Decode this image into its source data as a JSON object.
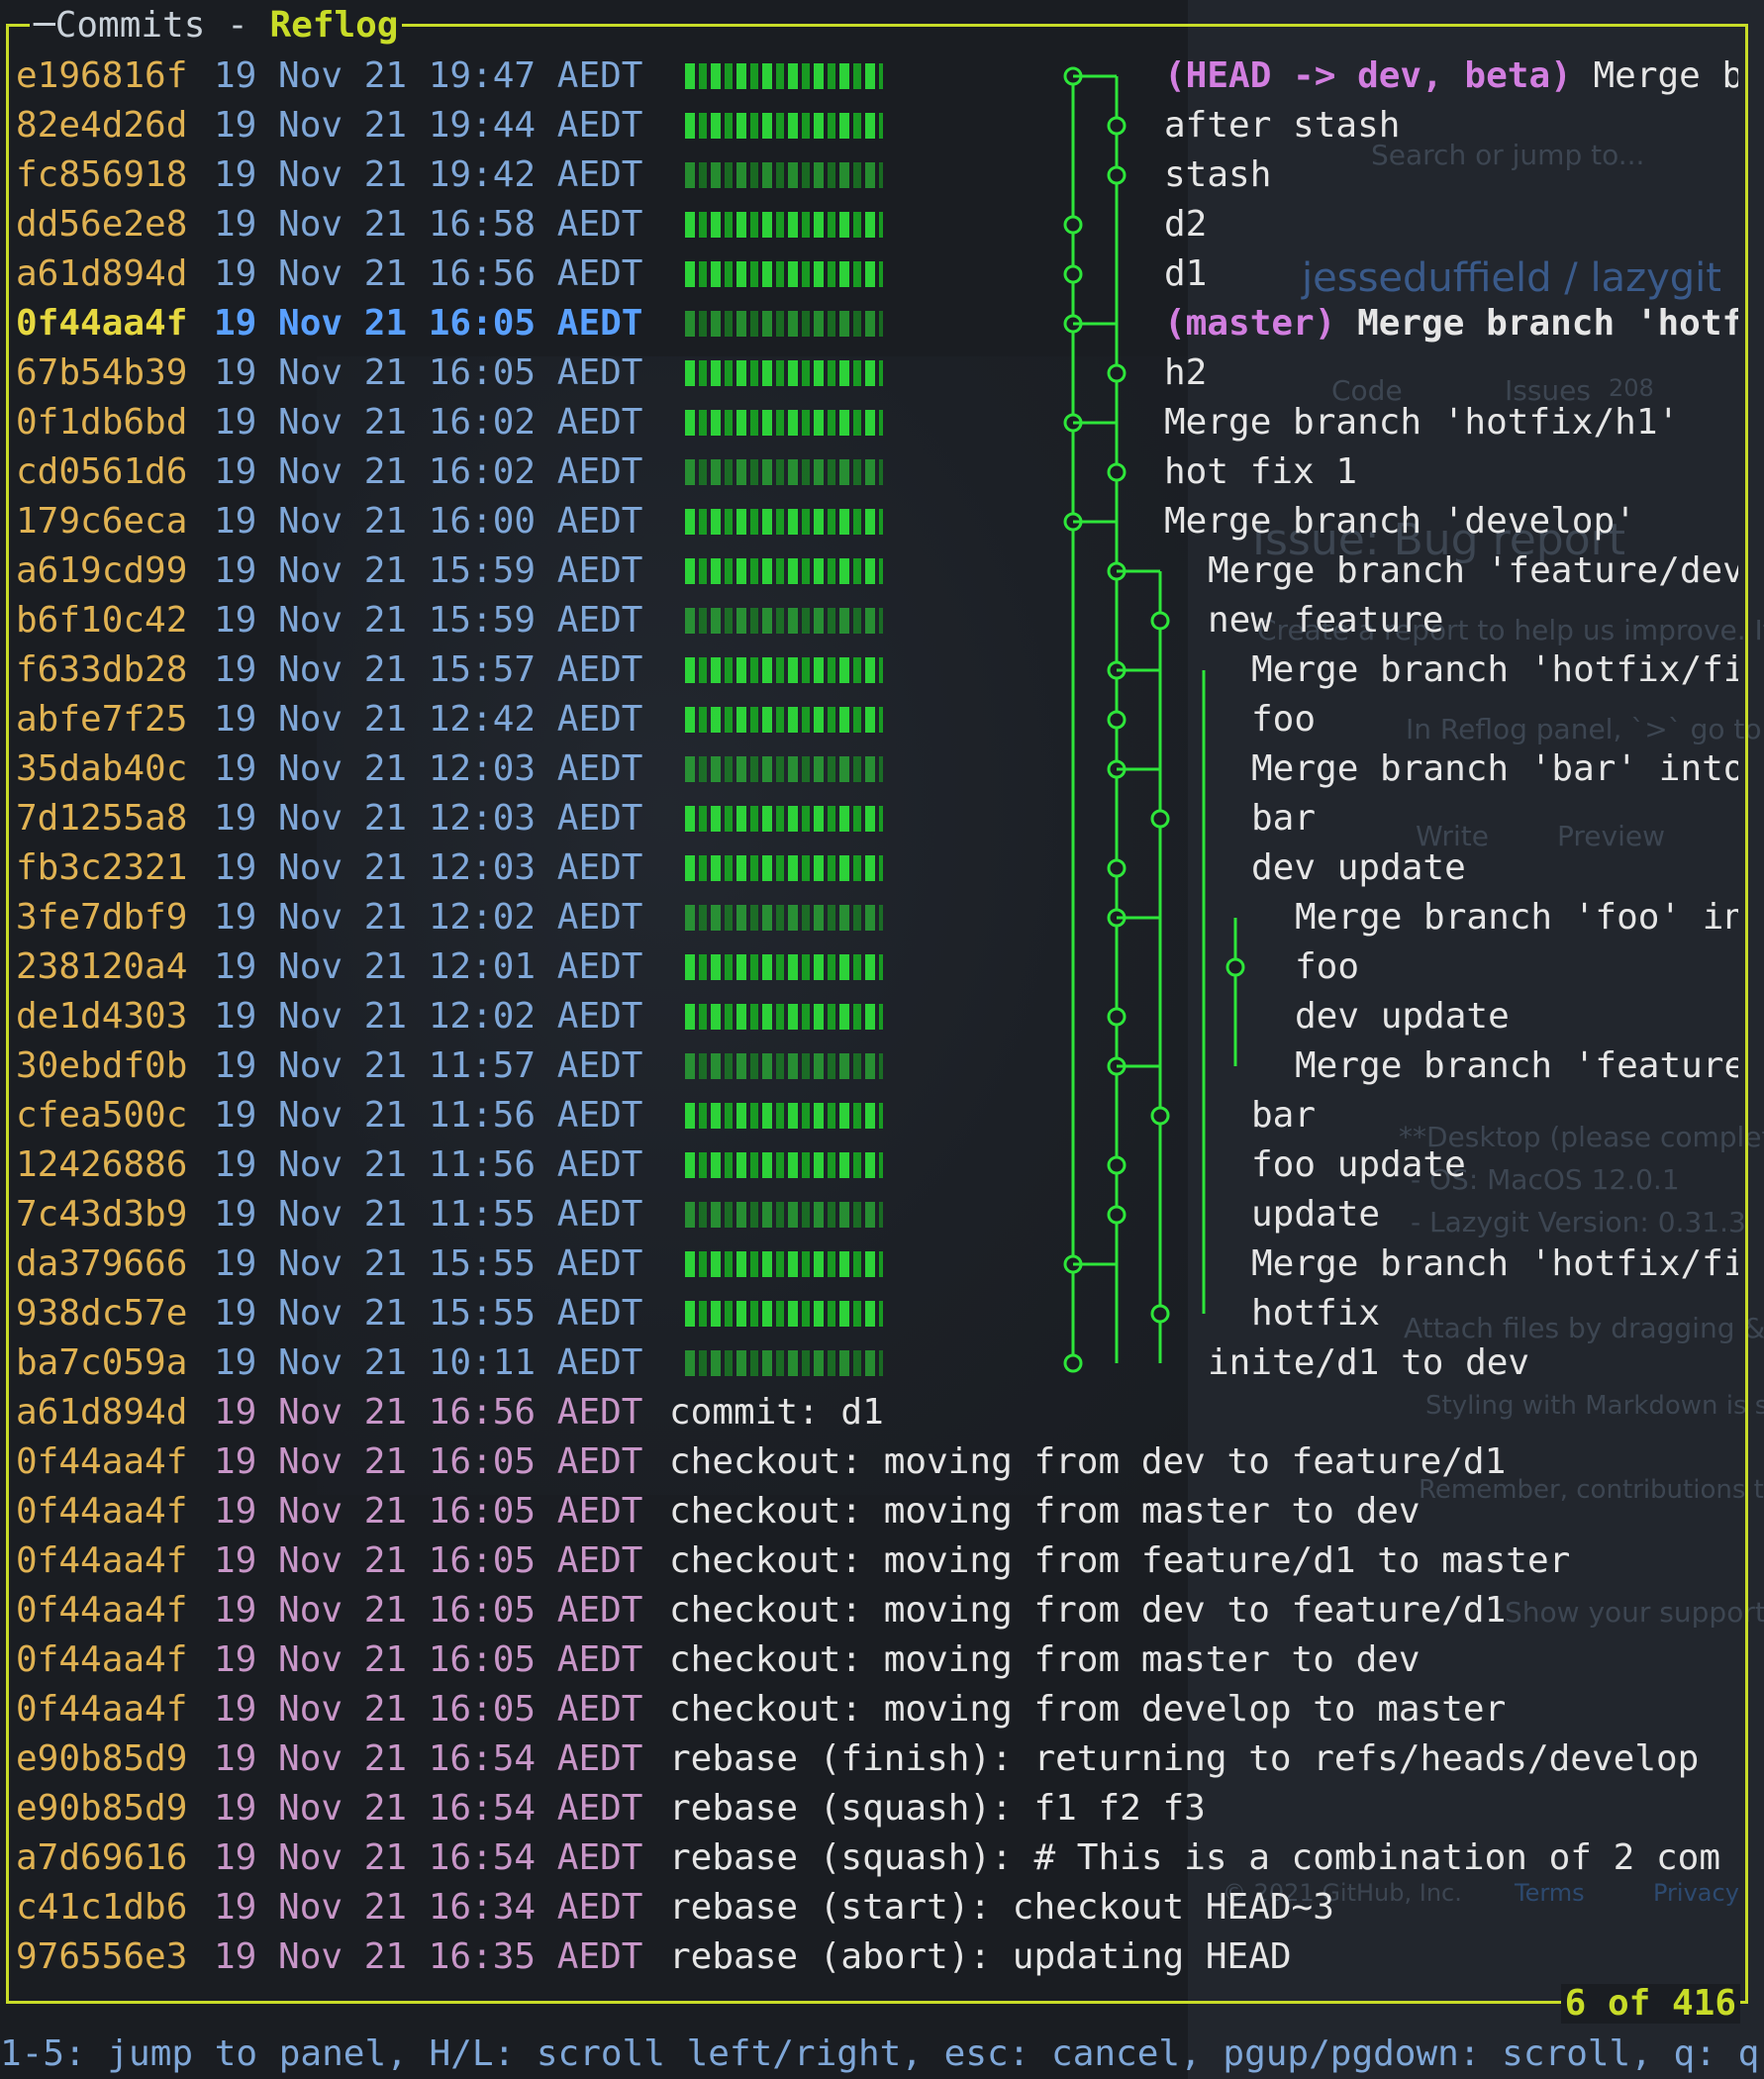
{
  "panel": {
    "title_prefix": "Commits - ",
    "title_active": "Reflog",
    "count": "6 of 416"
  },
  "background": {
    "search_placeholder": "Search or jump to...",
    "repo": "jesseduffield / lazygit",
    "tab_code": "Code",
    "tab_issues": "Issues",
    "issues_count": "208",
    "issue_title": "Issue: Bug report",
    "create_text": "Create a report to help us improve. If thi",
    "comment_preview": "In Reflog panel, `>` go to",
    "write_tab": "Write",
    "preview_tab": "Preview",
    "desktop": "**Desktop (please complete",
    "os": "- OS: MacOS 12.0.1",
    "version": "- Lazygit Version: 0.31.3",
    "attach": "Attach files by dragging & dro",
    "markdown": "Styling with Markdown is supp",
    "remember": "Remember, contributions to thi",
    "support": "Show your support fo",
    "copyright": "© 2021 GitHub, Inc.",
    "terms": "Terms",
    "privacy": "Privacy"
  },
  "commits": [
    {
      "hash": "e196816f",
      "date": "19 Nov 21 19:47 AEDT",
      "refs": "(HEAD -> dev, beta)",
      "msg": " Merge b"
    },
    {
      "hash": "82e4d26d",
      "date": "19 Nov 21 19:44 AEDT",
      "refs": "",
      "msg": "after stash"
    },
    {
      "hash": "fc856918",
      "date": "19 Nov 21 19:42 AEDT",
      "refs": "",
      "msg": "stash"
    },
    {
      "hash": "dd56e2e8",
      "date": "19 Nov 21 16:58 AEDT",
      "refs": "",
      "msg": "d2"
    },
    {
      "hash": "a61d894d",
      "date": "19 Nov 21 16:56 AEDT",
      "refs": "",
      "msg": "d1"
    },
    {
      "hash": "0f44aa4f",
      "date": "19 Nov 21 16:05 AEDT",
      "refs": "(master)",
      "msg": " Merge branch 'hotf"
    },
    {
      "hash": "67b54b39",
      "date": "19 Nov 21 16:05 AEDT",
      "refs": "",
      "msg": "h2"
    },
    {
      "hash": "0f1db6bd",
      "date": "19 Nov 21 16:02 AEDT",
      "refs": "",
      "msg": "Merge branch 'hotfix/h1'"
    },
    {
      "hash": "cd0561d6",
      "date": "19 Nov 21 16:02 AEDT",
      "refs": "",
      "msg": "hot fix 1"
    },
    {
      "hash": "179c6eca",
      "date": "19 Nov 21 16:00 AEDT",
      "refs": "",
      "msg": "Merge branch 'develop'"
    },
    {
      "hash": "a619cd99",
      "date": "19 Nov 21 15:59 AEDT",
      "refs": "",
      "msg": "Merge branch 'feature/dev"
    },
    {
      "hash": "b6f10c42",
      "date": "19 Nov 21 15:59 AEDT",
      "refs": "",
      "msg": "new feature"
    },
    {
      "hash": "f633db28",
      "date": "19 Nov 21 15:57 AEDT",
      "refs": "",
      "msg": "Merge branch 'hotfix/fi"
    },
    {
      "hash": "abfe7f25",
      "date": "19 Nov 21 12:42 AEDT",
      "refs": "",
      "msg": "foo"
    },
    {
      "hash": "35dab40c",
      "date": "19 Nov 21 12:03 AEDT",
      "refs": "",
      "msg": "Merge branch 'bar' into"
    },
    {
      "hash": "7d1255a8",
      "date": "19 Nov 21 12:03 AEDT",
      "refs": "",
      "msg": "bar"
    },
    {
      "hash": "fb3c2321",
      "date": "19 Nov 21 12:03 AEDT",
      "refs": "",
      "msg": "dev update"
    },
    {
      "hash": "3fe7dbf9",
      "date": "19 Nov 21 12:02 AEDT",
      "refs": "",
      "msg": "Merge branch 'foo' in"
    },
    {
      "hash": "238120a4",
      "date": "19 Nov 21 12:01 AEDT",
      "refs": "",
      "msg": "foo"
    },
    {
      "hash": "de1d4303",
      "date": "19 Nov 21 12:02 AEDT",
      "refs": "",
      "msg": "dev update"
    },
    {
      "hash": "30ebdf0b",
      "date": "19 Nov 21 11:57 AEDT",
      "refs": "",
      "msg": "Merge branch 'feature"
    },
    {
      "hash": "cfea500c",
      "date": "19 Nov 21 11:56 AEDT",
      "refs": "",
      "msg": "bar"
    },
    {
      "hash": "12426886",
      "date": "19 Nov 21 11:56 AEDT",
      "refs": "",
      "msg": "foo update"
    },
    {
      "hash": "7c43d3b9",
      "date": "19 Nov 21 11:55 AEDT",
      "refs": "",
      "msg": "update"
    },
    {
      "hash": "da379666",
      "date": "19 Nov 21 15:55 AEDT",
      "refs": "",
      "msg": "Merge branch 'hotfix/fi"
    },
    {
      "hash": "938dc57e",
      "date": "19 Nov 21 15:55 AEDT",
      "refs": "",
      "msg": "hotfix"
    },
    {
      "hash": "ba7c059a",
      "date": "19 Nov 21 10:11 AEDT",
      "refs": "",
      "msg": "inite/d1 to dev"
    }
  ],
  "reflog": [
    {
      "hash": "a61d894d",
      "date": "19 Nov 21 16:56 AEDT",
      "msg": "commit: d1"
    },
    {
      "hash": "0f44aa4f",
      "date": "19 Nov 21 16:05 AEDT",
      "msg": "checkout: moving from dev to feature/d1"
    },
    {
      "hash": "0f44aa4f",
      "date": "19 Nov 21 16:05 AEDT",
      "msg": "checkout: moving from master to dev"
    },
    {
      "hash": "0f44aa4f",
      "date": "19 Nov 21 16:05 AEDT",
      "msg": "checkout: moving from feature/d1 to master"
    },
    {
      "hash": "0f44aa4f",
      "date": "19 Nov 21 16:05 AEDT",
      "msg": "checkout: moving from dev to feature/d1"
    },
    {
      "hash": "0f44aa4f",
      "date": "19 Nov 21 16:05 AEDT",
      "msg": "checkout: moving from master to dev"
    },
    {
      "hash": "0f44aa4f",
      "date": "19 Nov 21 16:05 AEDT",
      "msg": "checkout: moving from develop to master"
    },
    {
      "hash": "e90b85d9",
      "date": "19 Nov 21 16:54 AEDT",
      "msg": "rebase (finish): returning to refs/heads/develop"
    },
    {
      "hash": "e90b85d9",
      "date": "19 Nov 21 16:54 AEDT",
      "msg": "rebase (squash): f1 f2 f3"
    },
    {
      "hash": "a7d69616",
      "date": "19 Nov 21 16:54 AEDT",
      "msg": "rebase (squash): # This is a combination of 2 com"
    },
    {
      "hash": "c41c1db6",
      "date": "19 Nov 21 16:34 AEDT",
      "msg": "rebase (start): checkout HEAD~3"
    },
    {
      "hash": "976556e3",
      "date": "19 Nov 21 16:35 AEDT",
      "msg": "rebase (abort): updating HEAD"
    }
  ],
  "statusbar": "1-5: jump to panel, H/L: scroll left/right, esc: cancel, pgup/pgdown: scroll, q: q",
  "colors": {
    "border": "#c8dc28",
    "hash": "#e0b252",
    "date": "#7fa7d8",
    "graph": "#2ee63a",
    "ref": "#d27ee0"
  }
}
